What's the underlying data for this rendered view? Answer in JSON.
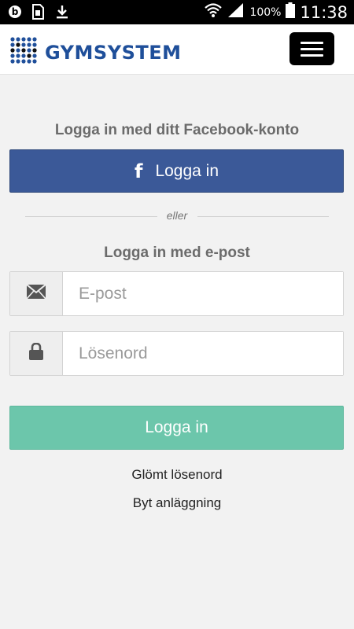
{
  "status_bar": {
    "battery": "100%",
    "time": "11:38"
  },
  "header": {
    "logo_text": "GYMSYSTEM"
  },
  "facebook": {
    "title": "Logga in med ditt Facebook-konto",
    "icon_glyph": "f",
    "button_label": "Logga in",
    "color": "#3b5998"
  },
  "divider": {
    "text": "eller"
  },
  "email_login": {
    "title": "Logga in med e-post",
    "email_placeholder": "E-post",
    "email_value": "",
    "password_placeholder": "Lösenord",
    "password_value": ""
  },
  "submit": {
    "label": "Logga in",
    "color": "#6cc6ab"
  },
  "links": {
    "forgot_password": "Glömt lösenord",
    "change_facility": "Byt anläggning"
  }
}
